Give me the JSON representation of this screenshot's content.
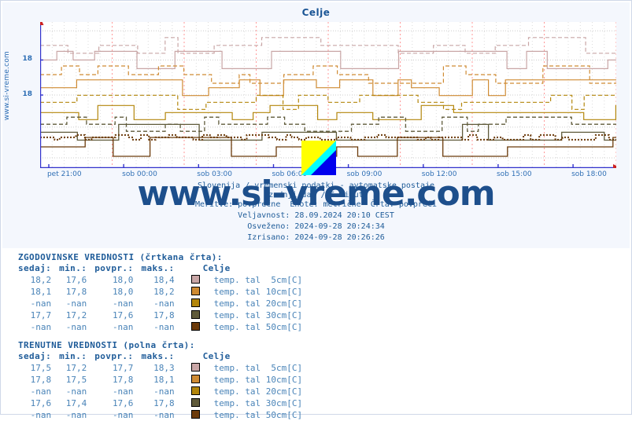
{
  "page": {
    "title": "Celje",
    "vertical_watermark": "www.si-vreme.com",
    "big_watermark": "www.si-vreme.com",
    "logo_name": "si-vreme-logo"
  },
  "meta": {
    "line1": "Slovenija / vremenski podatki - avtomatske postaje",
    "line2": "zadnji dan / 5 minut",
    "line3": "Meritve: povprečne  Enote: metrične  Črta: povpreči",
    "line4": "Veljavnost: 28.09.2024 20:10 CEST",
    "line5": "Osveženo: 2024-09-28 20:24:34",
    "line6": "Izrisano: 2024-09-28 20:26:26"
  },
  "chart_data": {
    "type": "line",
    "title": "Celje",
    "xlabel": "",
    "ylabel": "",
    "grid": true,
    "legend_position": "below-table",
    "xtick_labels": [
      "pet 21:00",
      "sob 00:00",
      "sob 03:00",
      "sob 06:00",
      "sob 09:00",
      "sob 12:00",
      "sob 15:00",
      "sob 18:00"
    ],
    "xtick_positions_pct": [
      1.5,
      14.5,
      27.5,
      40.5,
      53.5,
      66.5,
      79.5,
      92.5
    ],
    "ytick_labels": [
      "18",
      "18"
    ],
    "ytick_values": [
      18.5,
      18.0
    ],
    "ytick_positions_pct": [
      26,
      50
    ],
    "ylim": [
      16.8,
      19.1
    ],
    "xlim_label": "pet 21:00 - sob 20:00",
    "series": [
      {
        "name": "temp. tal  5cm[C] (zgodovinske)",
        "color": "#c9a6a6",
        "style": "dashed",
        "unit": "C",
        "min": 17.6,
        "avg": 18.0,
        "max": 18.4,
        "now": 18.2
      },
      {
        "name": "temp. tal 10cm[C] (zgodovinske)",
        "color": "#cf8b33",
        "style": "dashed",
        "unit": "C",
        "min": 17.8,
        "avg": 18.0,
        "max": 18.2,
        "now": 18.1
      },
      {
        "name": "temp. tal 20cm[C] (zgodovinske)",
        "color": "#b3860b",
        "style": "dashed",
        "unit": "C",
        "min": null,
        "avg": null,
        "max": null,
        "now": null
      },
      {
        "name": "temp. tal 30cm[C] (zgodovinske)",
        "color": "#5f5a3a",
        "style": "dashed",
        "unit": "C",
        "min": 17.2,
        "avg": 17.6,
        "max": 17.8,
        "now": 17.7
      },
      {
        "name": "temp. tal 50cm[C] (zgodovinske)",
        "color": "#6b3a0a",
        "style": "dashed",
        "unit": "C",
        "min": null,
        "avg": null,
        "max": null,
        "now": null
      },
      {
        "name": "temp. tal  5cm[C] (trenutne)",
        "color": "#c9a6a6",
        "style": "solid",
        "unit": "C",
        "min": 17.2,
        "avg": 17.7,
        "max": 18.3,
        "now": 17.5
      },
      {
        "name": "temp. tal 10cm[C] (trenutne)",
        "color": "#cf8b33",
        "style": "solid",
        "unit": "C",
        "min": 17.5,
        "avg": 17.8,
        "max": 18.1,
        "now": 17.8
      },
      {
        "name": "temp. tal 20cm[C] (trenutne)",
        "color": "#b3860b",
        "style": "solid",
        "unit": "C",
        "min": null,
        "avg": null,
        "max": null,
        "now": null
      },
      {
        "name": "temp. tal 30cm[C] (trenutne)",
        "color": "#5f5a3a",
        "style": "solid",
        "unit": "C",
        "min": 17.4,
        "avg": 17.6,
        "max": 17.8,
        "now": 17.6
      },
      {
        "name": "temp. tal 50cm[C] (trenutne)",
        "color": "#6b3a0a",
        "style": "solid",
        "unit": "C",
        "min": null,
        "avg": null,
        "max": null,
        "now": null
      }
    ]
  },
  "historical": {
    "heading": "ZGODOVINSKE VREDNOSTI (črtkana črta):",
    "columns": [
      "sedaj:",
      "min.:",
      "povpr.:",
      "maks.:",
      "Celje"
    ],
    "rows": [
      {
        "now": "18,2",
        "min": "17,6",
        "avg": "18,0",
        "max": "18,4",
        "color": "#c9a6a6",
        "label": "temp. tal  5cm[C]"
      },
      {
        "now": "18,1",
        "min": "17,8",
        "avg": "18,0",
        "max": "18,2",
        "color": "#cf8b33",
        "label": "temp. tal 10cm[C]"
      },
      {
        "now": "-nan",
        "min": "-nan",
        "avg": "-nan",
        "max": "-nan",
        "color": "#b3860b",
        "label": "temp. tal 20cm[C]"
      },
      {
        "now": "17,7",
        "min": "17,2",
        "avg": "17,6",
        "max": "17,8",
        "color": "#5f5a3a",
        "label": "temp. tal 30cm[C]"
      },
      {
        "now": "-nan",
        "min": "-nan",
        "avg": "-nan",
        "max": "-nan",
        "color": "#6b3a0a",
        "label": "temp. tal 50cm[C]"
      }
    ]
  },
  "current": {
    "heading": "TRENUTNE VREDNOSTI (polna črta):",
    "columns": [
      "sedaj:",
      "min.:",
      "povpr.:",
      "maks.:",
      "Celje"
    ],
    "rows": [
      {
        "now": "17,5",
        "min": "17,2",
        "avg": "17,7",
        "max": "18,3",
        "color": "#c9a6a6",
        "label": "temp. tal  5cm[C]"
      },
      {
        "now": "17,8",
        "min": "17,5",
        "avg": "17,8",
        "max": "18,1",
        "color": "#cf8b33",
        "label": "temp. tal 10cm[C]"
      },
      {
        "now": "-nan",
        "min": "-nan",
        "avg": "-nan",
        "max": "-nan",
        "color": "#b3860b",
        "label": "temp. tal 20cm[C]"
      },
      {
        "now": "17,6",
        "min": "17,4",
        "avg": "17,6",
        "max": "17,8",
        "color": "#5f5a3a",
        "label": "temp. tal 30cm[C]"
      },
      {
        "now": "-nan",
        "min": "-nan",
        "avg": "-nan",
        "max": "-nan",
        "color": "#6b3a0a",
        "label": "temp. tal 50cm[C]"
      }
    ]
  },
  "colors": {
    "axis": "#3333cc",
    "grid_minor": "#ffb3b3",
    "grid_major": "#cccccc",
    "text_blue": "#1f5c99",
    "value_blue": "#4a84b8",
    "panel_bg": "#f4f7fd"
  }
}
